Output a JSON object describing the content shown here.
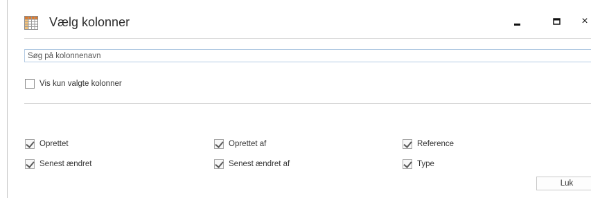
{
  "dialog": {
    "title": "Vælg kolonner",
    "window_controls": {
      "minimize_icon": "minimize-icon",
      "maximize_icon": "maximize-icon",
      "close_icon": "close-icon",
      "close_glyph": "×"
    },
    "search": {
      "placeholder": "Søg på kolonnenavn",
      "value": ""
    },
    "show_selected_only": {
      "label": "Vis kun valgte kolonner",
      "checked": false
    },
    "columns": [
      {
        "label": "Oprettet",
        "checked": true
      },
      {
        "label": "Oprettet af",
        "checked": true
      },
      {
        "label": "Reference",
        "checked": true
      },
      {
        "label": "Senest ændret",
        "checked": true
      },
      {
        "label": "Senest ændret af",
        "checked": true
      },
      {
        "label": "Type",
        "checked": true
      }
    ],
    "close_button_label": "Luk"
  }
}
